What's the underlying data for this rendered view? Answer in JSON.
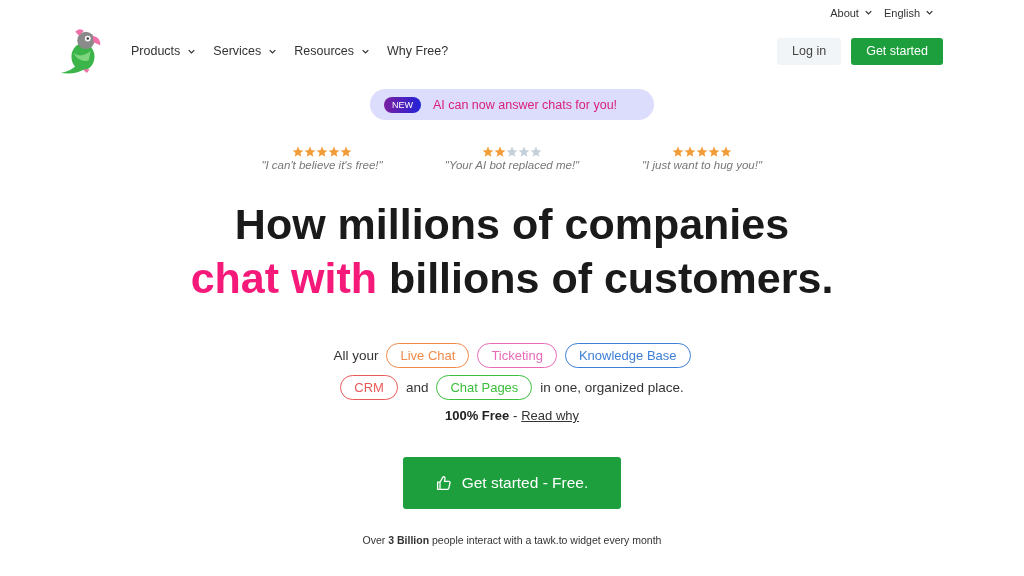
{
  "top_links": [
    {
      "label": "About",
      "dropdown": true
    },
    {
      "label": "English",
      "dropdown": true
    }
  ],
  "nav": {
    "items": [
      {
        "label": "Products",
        "dropdown": true
      },
      {
        "label": "Services",
        "dropdown": true
      },
      {
        "label": "Resources",
        "dropdown": true
      },
      {
        "label": "Why Free?",
        "dropdown": false
      }
    ],
    "login": "Log in",
    "get_started": "Get started"
  },
  "announcement": {
    "badge": "NEW",
    "text": "AI can now answer chats for you!"
  },
  "reviews": [
    {
      "stars": 5,
      "quote": "\"I can't believe it's free!\""
    },
    {
      "stars": 2,
      "quote": "\"Your AI bot replaced me!\""
    },
    {
      "stars": 5,
      "quote": "\"I just want to hug you!\""
    }
  ],
  "headline": {
    "line_1": "How millions of companies",
    "highlight": "chat with",
    "line_2_rest": "billions of customers."
  },
  "product_lines": [
    [
      {
        "kind": "text",
        "text": "All your"
      },
      {
        "kind": "tag",
        "text": "Live Chat",
        "color": "#f08a4b"
      },
      {
        "kind": "tag",
        "text": "Ticketing",
        "color": "#e86bb8"
      },
      {
        "kind": "tag",
        "text": "Knowledge Base",
        "color": "#3d7fd6"
      }
    ],
    [
      {
        "kind": "tag",
        "text": "CRM",
        "color": "#ea5a5a"
      },
      {
        "kind": "text",
        "text": "and"
      },
      {
        "kind": "tag",
        "text": "Chat Pages",
        "color": "#3cbf3c"
      },
      {
        "kind": "text",
        "text": "in one, organized place."
      }
    ]
  ],
  "free_note": {
    "label": "**100% Free** -",
    "link": "Read why"
  },
  "cta": "Get started - Free.",
  "footnote": "Over **3 Billion** people interact with a tawk.to widget every month"
}
